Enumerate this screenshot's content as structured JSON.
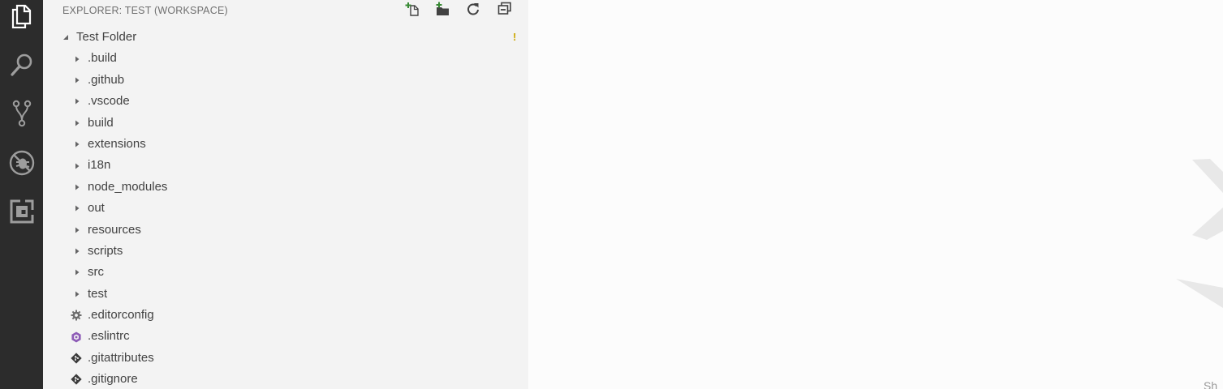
{
  "activity_bar": {
    "items": [
      {
        "name": "explorer",
        "icon": "files-icon"
      },
      {
        "name": "search",
        "icon": "search-icon"
      },
      {
        "name": "source-control",
        "icon": "source-control-icon"
      },
      {
        "name": "debug",
        "icon": "debug-icon"
      },
      {
        "name": "extensions",
        "icon": "extensions-icon"
      }
    ]
  },
  "sidebar": {
    "title": "EXPLORER: TEST (WORKSPACE)",
    "actions": [
      "new-file-icon",
      "new-folder-icon",
      "refresh-icon",
      "collapse-all-icon"
    ],
    "root_folder": {
      "label": "Test Folder",
      "badge": "!"
    },
    "folders": [
      {
        "label": ".build"
      },
      {
        "label": ".github"
      },
      {
        "label": ".vscode"
      },
      {
        "label": "build"
      },
      {
        "label": "extensions"
      },
      {
        "label": "i18n"
      },
      {
        "label": "node_modules"
      },
      {
        "label": "out"
      },
      {
        "label": "resources"
      },
      {
        "label": "scripts"
      },
      {
        "label": "src"
      },
      {
        "label": "test"
      }
    ],
    "files": [
      {
        "label": ".editorconfig",
        "icon": "gear-icon"
      },
      {
        "label": ".eslintrc",
        "icon": "eslint-icon"
      },
      {
        "label": ".gitattributes",
        "icon": "git-icon"
      },
      {
        "label": ".gitignore",
        "icon": "git-icon"
      }
    ]
  },
  "colors": {
    "activity_bar_bg": "#2c2c2c",
    "sidebar_bg": "#f3f3f3",
    "editor_bg": "#fcfcfc",
    "warning": "#cca700",
    "eslint": "#8e5cb7",
    "new_item_accent": "#388a34"
  },
  "editor": {
    "hint": "Sh"
  }
}
